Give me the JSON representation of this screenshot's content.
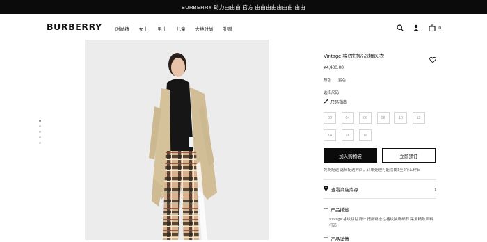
{
  "topbar": {
    "text": "BURBERRY 助力由由由 官方 由由由由由由由 由由"
  },
  "header": {
    "logo": "BURBERRY",
    "nav": [
      "时尚精",
      "女士",
      "男士",
      "儿童",
      "大地时尚",
      "礼赠"
    ],
    "active_nav_index": 1,
    "icons": [
      "search-icon",
      "account-icon",
      "bag-icon"
    ],
    "bag_count": "0"
  },
  "gallery": {
    "dots_count": 5,
    "active_dot": 0
  },
  "product": {
    "title": "Vintage 格纹拼贴战壕风衣",
    "price": "¥4,400.00",
    "color_label": "颜色",
    "color_value": "蜜色",
    "size_label": "选择尺码",
    "size_guide": "尺码指南",
    "sizes": [
      "02",
      "04",
      "06",
      "08",
      "10",
      "12",
      "14",
      "16",
      "18"
    ],
    "add_to_bag": "加入购物袋",
    "find_in_store": "立即预订",
    "note": "免费配送 选择配送时间，订单处理可能需要1至2个工作日",
    "store_link": "查看商店库存",
    "details_title": "产品描述",
    "details_text": "Vintage 格纹拼贴设计 搭配标志性格纹装饰细节 采用精致面料打造",
    "details_title2": "产品详情"
  }
}
